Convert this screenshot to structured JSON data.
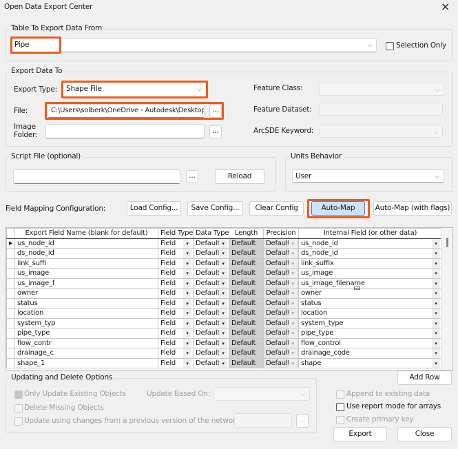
{
  "window": {
    "title": "Open Data Export Center",
    "close_icon": "×"
  },
  "table_group": {
    "label": "Table To Export Data From",
    "table_value": "Pipe",
    "selection_only": "Selection Only"
  },
  "export_group": {
    "label": "Export Data To",
    "export_type_label": "Export Type:",
    "export_type_value": "Shape File",
    "file_label": "File:",
    "file_value": "C:\\Users\\solberk\\OneDrive - Autodesk\\Desktop\\IA",
    "image_folder_label": "Image Folder:",
    "browse": "...",
    "feature_class_label": "Feature Class:",
    "feature_dataset_label": "Feature Dataset:",
    "arcsde_label": "ArcSDE Keyword:"
  },
  "script_group": {
    "label": "Script File (optional)",
    "browse": "...",
    "reload": "Reload"
  },
  "units_group": {
    "label": "Units Behavior",
    "value": "User"
  },
  "mapping": {
    "label": "Field Mapping Configuration:",
    "load": "Load Config...",
    "save": "Save Config...",
    "clear": "Clear Config",
    "auto": "Auto-Map",
    "auto_flags": "Auto-Map (with flags)"
  },
  "grid": {
    "headers": [
      "Export Field Name (blank for default)",
      "Field Type",
      "Data Type",
      "Length",
      "Precision",
      "Internal Field (or other data)"
    ],
    "rows": [
      [
        "us_node_id",
        "Field",
        "Default",
        "Default",
        "Default",
        "us_node_id"
      ],
      [
        "ds_node_id",
        "Field",
        "Default",
        "Default",
        "Default",
        "ds_node_id"
      ],
      [
        "link_suffi",
        "Field",
        "Default",
        "Default",
        "Default",
        "link_suffix"
      ],
      [
        "us_image",
        "Field",
        "Default",
        "Default",
        "Default",
        "us_image"
      ],
      [
        "us_image_f",
        "Field",
        "Default",
        "Default",
        "Default",
        "us_image_filename"
      ],
      [
        "owner",
        "Field",
        "Default",
        "Default",
        "Default",
        "owner"
      ],
      [
        "status",
        "Field",
        "Default",
        "Default",
        "Default",
        "status"
      ],
      [
        "location",
        "Field",
        "Default",
        "Default",
        "Default",
        "location"
      ],
      [
        "system_typ",
        "Field",
        "Default",
        "Default",
        "Default",
        "system_type"
      ],
      [
        "pipe_type",
        "Field",
        "Default",
        "Default",
        "Default",
        "pipe_type"
      ],
      [
        "flow_contr",
        "Field",
        "Default",
        "Default",
        "Default",
        "flow_control"
      ],
      [
        "drainage_c",
        "Field",
        "Default",
        "Default",
        "Default",
        "drainage_code"
      ],
      [
        "shape_1",
        "Field",
        "Default",
        "Default",
        "Default",
        "shape"
      ]
    ]
  },
  "add_row": "Add Row",
  "update_group": {
    "label": "Updating and Delete Options",
    "only_update": "Only Update Existing Objects",
    "update_based_on": "Update Based On:",
    "delete_missing": "Delete Missing Objects",
    "update_changes": "Update using changes from a previous version of the network:",
    "browse": "..."
  },
  "options": {
    "append": "Append to existing data",
    "report_mode": "Use report mode for arrays",
    "primary_key": "Create primary key"
  },
  "export": "Export",
  "close": "Close"
}
